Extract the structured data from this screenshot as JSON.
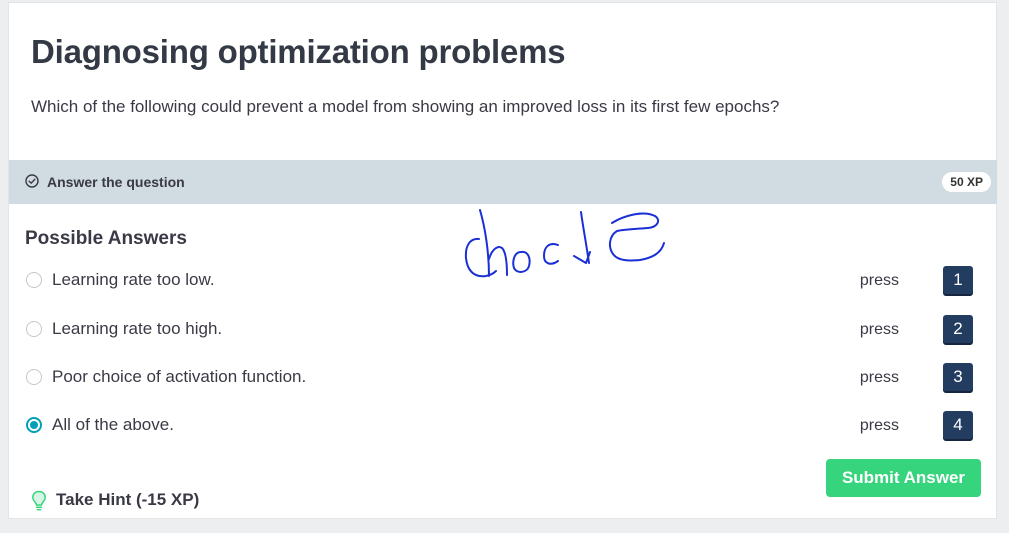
{
  "exercise": {
    "title": "Diagnosing optimization problems",
    "question": "Which of the following could prevent a model from showing an improved loss in its first few epochs?"
  },
  "banner": {
    "icon": "check-circle-icon",
    "label": "Answer the question",
    "xp": "50 XP"
  },
  "answers": {
    "heading": "Possible Answers",
    "selected_index": 3,
    "options": [
      {
        "label": "Learning rate too low.",
        "press": "press",
        "key": "1",
        "selected": false
      },
      {
        "label": "Learning rate too high.",
        "press": "press",
        "key": "2",
        "selected": false
      },
      {
        "label": "Poor choice of activation function.",
        "press": "press",
        "key": "3",
        "selected": false
      },
      {
        "label": "All of the above.",
        "press": "press",
        "key": "4",
        "selected": true
      }
    ]
  },
  "actions": {
    "submit_label": "Submit Answer",
    "hint_label": "Take Hint (-15 XP)",
    "hint_icon": "lightbulb-icon"
  },
  "annotation": {
    "handwritten_text": "chode",
    "ink_color": "#1a2fd6"
  },
  "colors": {
    "accent": "#03a0b8",
    "submit": "#36d57d",
    "key_bg": "#233d61",
    "banner_bg": "#d0dbe2"
  }
}
